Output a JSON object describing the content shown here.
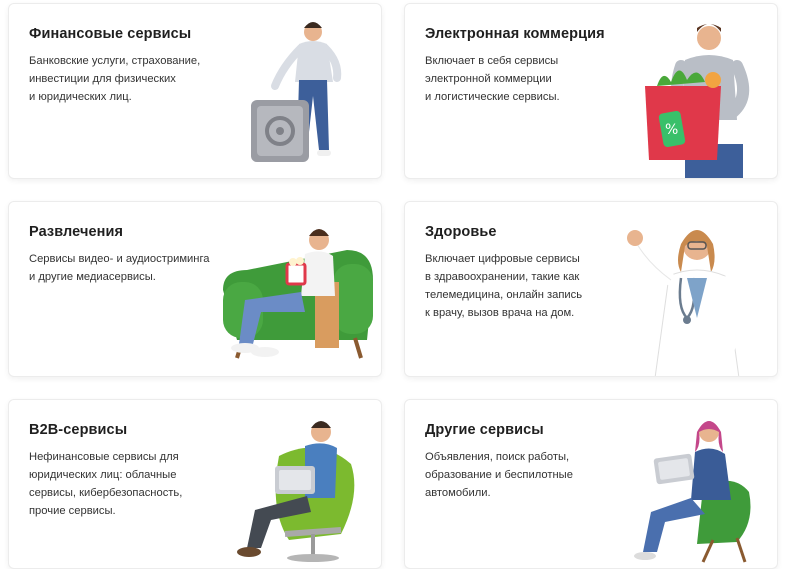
{
  "cards": [
    {
      "title": "Финансовые сервисы",
      "desc": "Банковские услуги, страхование,\nинвестиции для физических\nи юридических лиц.",
      "illustration": "person-with-safe-icon"
    },
    {
      "title": "Электронная коммерция",
      "desc": "Включает в себя сервисы\nэлектронной коммерции\nи логистические сервисы.",
      "illustration": "person-with-shopping-bag-icon"
    },
    {
      "title": "Развлечения",
      "desc": "Сервисы видео- и аудиостриминга\nи другие медиасервисы.",
      "illustration": "person-in-armchair-with-popcorn-icon"
    },
    {
      "title": "Здоровье",
      "desc": "Включает цифровые сервисы\nв здравоохранении, такие как\nтелемедицина, онлайн запись\nк врачу, вызов врача на дом.",
      "illustration": "doctor-icon"
    },
    {
      "title": "B2B-сервисы",
      "desc": "Нефинансовые сервисы для\nюридических лиц: облачные\nсервисы, кибербезопасность,\nпрочие сервисы.",
      "illustration": "person-with-laptop-in-chair-icon"
    },
    {
      "title": "Другие сервисы",
      "desc": "Объявления, поиск работы,\nобразование и беспилотные\nавтомобили.",
      "illustration": "woman-with-laptop-in-chair-icon"
    }
  ],
  "colors": {
    "card_border": "#ececec",
    "chair_green": "#3f9b3a",
    "bag_red": "#e0384a",
    "safe_grey": "#9a9ca3"
  }
}
